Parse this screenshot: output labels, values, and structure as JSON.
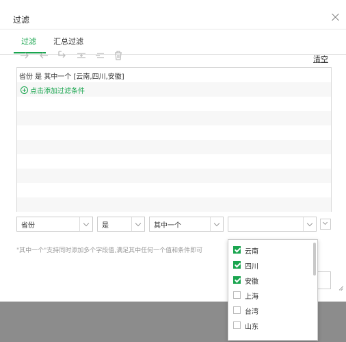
{
  "dialog": {
    "title": "过滤"
  },
  "tabs": [
    {
      "label": "过滤"
    },
    {
      "label": "汇总过滤"
    }
  ],
  "toolbar": {
    "icons": [
      "arrow-right-icon",
      "arrow-left-icon",
      "indent-icon",
      "add-condition-icon",
      "remove-condition-icon",
      "trash-icon"
    ],
    "clear_label": "清空"
  },
  "conditions": {
    "items": [
      {
        "text": "省份 是 其中一个 [云南,四川,安徽]"
      }
    ],
    "add_label": "点击添加过滤条件"
  },
  "editor": {
    "field": "省份",
    "operator": "是",
    "mode": "其中一个",
    "value": ""
  },
  "hint": "\"其中一个\"支持同时添加多个字段值,满足其中任何一个值和条件即可",
  "dropdown": {
    "options": [
      {
        "label": "云南",
        "checked": true
      },
      {
        "label": "四川",
        "checked": true
      },
      {
        "label": "安徽",
        "checked": true
      },
      {
        "label": "上海",
        "checked": false
      },
      {
        "label": "台湾",
        "checked": false
      },
      {
        "label": "山东",
        "checked": false
      }
    ]
  },
  "colors": {
    "accent": "#1aa54f",
    "overlay": "#8c8c8c"
  }
}
